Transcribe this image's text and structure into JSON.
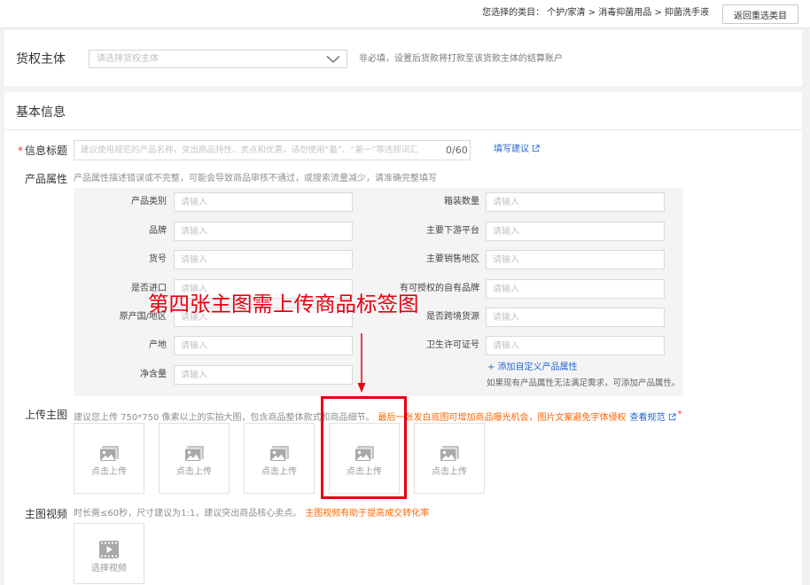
{
  "top_bar": {
    "category_prefix": "您选择的类目：",
    "category_path": "个护/家清 > 消毒抑菌用品 > 抑菌洗手液",
    "back_button": "返回重选类目"
  },
  "owner": {
    "label": "货权主体",
    "placeholder": "请选择货权主体",
    "hint": "非必填，设置后货款将打款至该货款主体的结算账户",
    "icon": "chevron-down-icon"
  },
  "basic_info": {
    "heading": "基本信息",
    "title_field": {
      "required_mark": "*",
      "label": "信息标题",
      "placeholder": "建议使用规范的产品名称，突出商品特性、卖点和优惠，请勿使用“最”、“第一”等违规词汇",
      "counter": "0/60",
      "suggest_link": "填写建议",
      "suggest_icon": "external-link-icon"
    },
    "attributes": {
      "label": "产品属性",
      "hint": "产品属性描述错误或不完整，可能会导致商品审核不通过，或搜索流量减少，请准确完整填写",
      "input_placeholder": "请输入",
      "left": [
        {
          "label": "产品类别"
        },
        {
          "label": "品牌"
        },
        {
          "label": "货号"
        },
        {
          "label": "是否进口"
        },
        {
          "label": "原产国/地区"
        },
        {
          "label": "产地"
        },
        {
          "label": "净含量"
        }
      ],
      "right": [
        {
          "label": "箱装数量"
        },
        {
          "label": "主要下游平台"
        },
        {
          "label": "主要销售地区"
        },
        {
          "label": "有可授权的自有品牌"
        },
        {
          "label": "是否跨境货源"
        },
        {
          "label": "卫生许可证号"
        }
      ],
      "add_link": "+ 添加自定义产品属性",
      "add_hint": "如果现有产品属性无法满足需求，可添加产品属性。"
    }
  },
  "main_images": {
    "label": "上传主图",
    "hint": "建议您上传 750*750 像素以上的实拍大图，包含商品整体款式和商品细节。",
    "hint_highlight": "最后一张发白底图可增加商品曝光机会，图片文案避免字体侵权",
    "spec_link": "查看规范",
    "spec_icon": "external-link-icon",
    "required_mark": "*",
    "slots": [
      {
        "label": "点击上传",
        "icon": "image-icon"
      },
      {
        "label": "点击上传",
        "icon": "image-icon"
      },
      {
        "label": "点击上传",
        "icon": "image-icon"
      },
      {
        "label": "点击上传",
        "icon": "image-icon"
      },
      {
        "label": "点击上传",
        "icon": "image-icon"
      }
    ]
  },
  "main_video": {
    "label": "主图视频",
    "hint": "时长需≤60秒，尺寸建议为1:1，建议突出商品核心卖点。",
    "hint_highlight": "主图视频有助于提高成交转化率",
    "upload_label": "选择视频",
    "icon": "video-icon"
  },
  "annotation": {
    "text": "第四张主图需上传商品标签图"
  },
  "colors": {
    "link_blue": "#2a66d4",
    "highlight_orange": "#ff6600",
    "annotation_red": "#e60012",
    "required_red": "#e4393c"
  }
}
